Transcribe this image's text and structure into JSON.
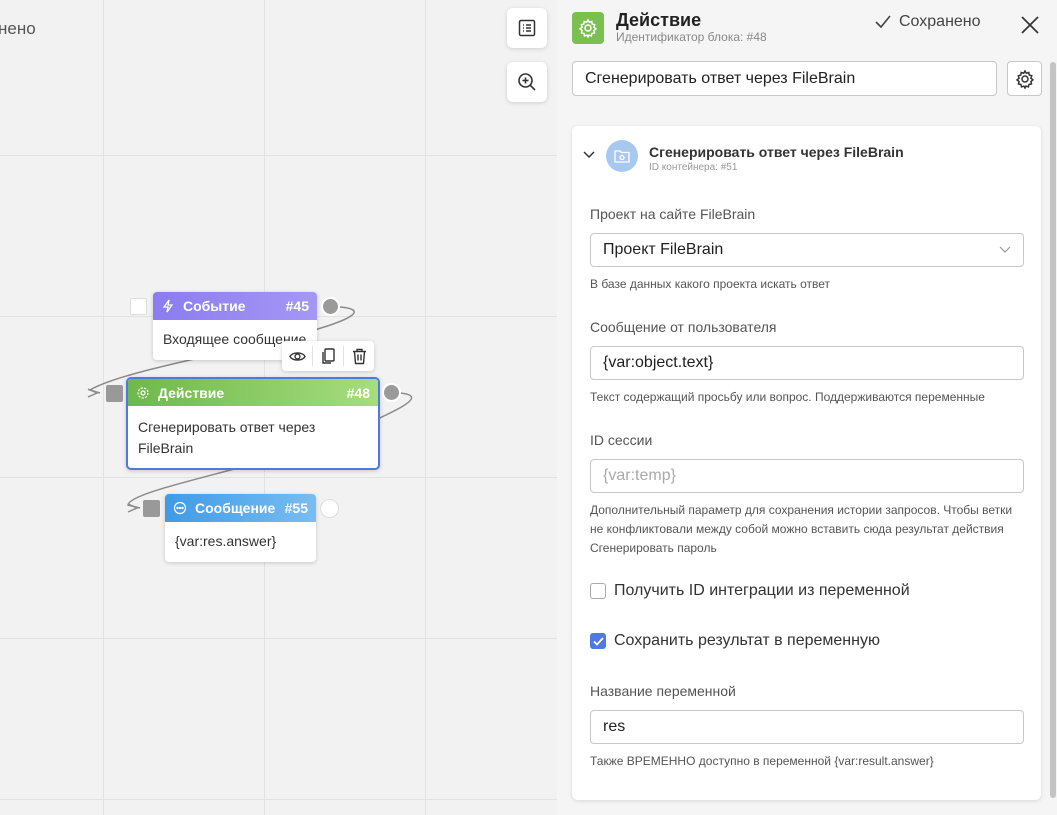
{
  "canvas": {
    "status_text": "нено",
    "nodes": {
      "event": {
        "title": "Событие",
        "id": "#45",
        "body": "Входящее сообщение",
        "color": "#8e80f0"
      },
      "action": {
        "title": "Действие",
        "id": "#48",
        "body": "Сгенерировать ответ через FileBrain",
        "color": "#79c04e",
        "border": "#4d79e0"
      },
      "message": {
        "title": "Сообщение",
        "id": "#55",
        "body": "{var:res.answer}",
        "color": "#4aa3e8"
      }
    },
    "tool_icons": [
      "list-icon",
      "zoom-in-icon"
    ],
    "node_toolbar_icons": [
      "eye-icon",
      "copy-icon",
      "trash-icon"
    ]
  },
  "panel": {
    "title": "Действие",
    "subtitle": "Идентификатор блока: #48",
    "saved_label": "Сохранено",
    "block_title_value": "Сгенерировать ответ через FileBrain",
    "container": {
      "title": "Сгенерировать ответ через FileBrain",
      "subtitle": "ID контейнера: #51"
    },
    "fields": {
      "project": {
        "label": "Проект на сайте FileBrain",
        "value": "Проект FileBrain",
        "hint": "В базе данных какого проекта искать ответ"
      },
      "message": {
        "label": "Сообщение от пользователя",
        "value": "{var:object.text}",
        "hint": "Текст содержащий просьбу или вопрос. Поддерживаются переменные"
      },
      "session": {
        "label": "ID сессии",
        "placeholder": "{var:temp}",
        "hint": "Дополнительный параметр для сохранения истории запросов. Чтобы ветки не конфликтовали между собой можно вставить сюда результат действия Сгенерировать пароль"
      },
      "integration_checkbox": {
        "label": "Получить ID интеграции из переменной",
        "checked": false
      },
      "save_checkbox": {
        "label": "Сохранить результат в переменную",
        "checked": true
      },
      "var_name": {
        "label": "Название переменной",
        "value": "res",
        "hint": "Также ВРЕМЕННО доступно в переменной {var:result.answer}"
      }
    }
  }
}
